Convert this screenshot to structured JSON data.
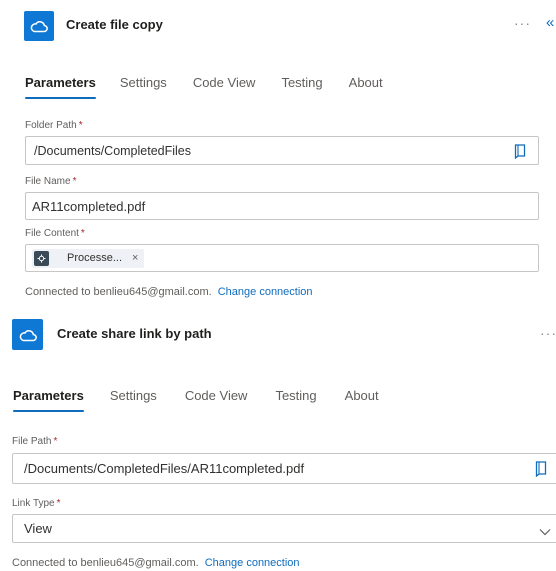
{
  "action1": {
    "title": "Create file copy",
    "icon": "onedrive-cloud-icon",
    "more_label": "···",
    "collapse_label": "«",
    "tabs": [
      {
        "label": "Parameters",
        "active": true
      },
      {
        "label": "Settings",
        "active": false
      },
      {
        "label": "Code View",
        "active": false
      },
      {
        "label": "Testing",
        "active": false
      },
      {
        "label": "About",
        "active": false
      }
    ],
    "folder_path": {
      "label": "Folder Path",
      "required_mark": "*",
      "value": "/Documents/CompletedFiles"
    },
    "file_name": {
      "label": "File Name",
      "required_mark": "*",
      "value": "AR11completed.pdf"
    },
    "file_content": {
      "label": "File Content",
      "required_mark": "*",
      "token_label": "Processe...",
      "token_remove": "×"
    },
    "connection": {
      "text": "Connected to benlieu645@gmail.com.",
      "change_label": "Change connection"
    }
  },
  "action2": {
    "title": "Create share link by path",
    "icon": "onedrive-cloud-icon",
    "more_label": "···",
    "tabs": [
      {
        "label": "Parameters",
        "active": true
      },
      {
        "label": "Settings",
        "active": false
      },
      {
        "label": "Code View",
        "active": false
      },
      {
        "label": "Testing",
        "active": false
      },
      {
        "label": "About",
        "active": false
      }
    ],
    "file_path": {
      "label": "File Path",
      "required_mark": "*",
      "value": "/Documents/CompletedFiles/AR11completed.pdf"
    },
    "link_type": {
      "label": "Link Type",
      "required_mark": "*",
      "value": "View"
    },
    "connection": {
      "text": "Connected to benlieu645@gmail.com.",
      "change_label": "Change connection"
    }
  },
  "colors": {
    "accent": "#0f78d4",
    "link": "#0f6cbd",
    "required": "#a4262c"
  }
}
